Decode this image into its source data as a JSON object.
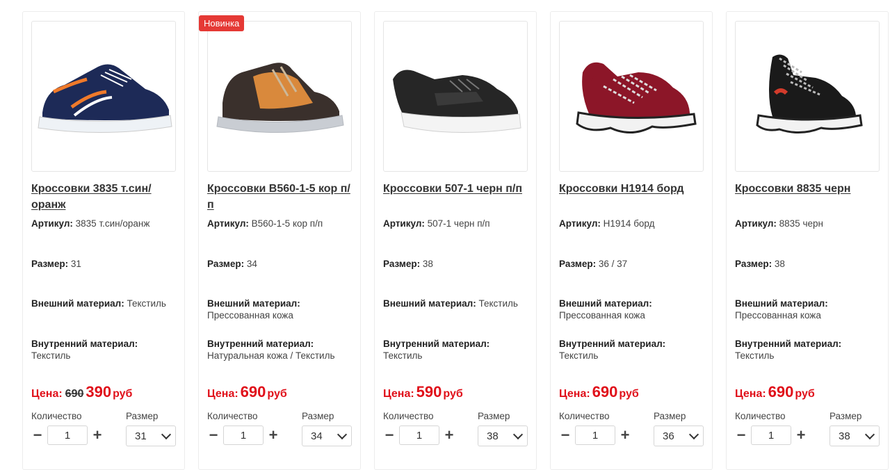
{
  "labels": {
    "article": "Артикул:",
    "size": "Размер:",
    "outer_material": "Внешний материал:",
    "inner_material": "Внутренний материал:",
    "price": "Цена:",
    "currency": "руб",
    "quantity": "Количество",
    "size_select": "Размер",
    "minus": "−",
    "plus": "+"
  },
  "products": [
    {
      "badge": "",
      "title": "Кроссовки 3835 т.син/оранж",
      "article": "3835 т.син/оранж",
      "size": "31",
      "outer_material": "Текстиль",
      "inner_material": "Текстиль",
      "old_price": "690",
      "price": "390",
      "quantity": "1",
      "selected_size": "31",
      "colors": {
        "upper": "#1d2a57",
        "accent": "#f07a2a",
        "sole": "#eef2f6"
      }
    },
    {
      "badge": "Новинка",
      "title": "Кроссовки B560-1-5 кор п/п",
      "article": "B560-1-5 кор п/п",
      "size": "34",
      "outer_material": "Прессованная кожа",
      "inner_material": "Натуральная кожа / Текстиль",
      "old_price": "",
      "price": "690",
      "quantity": "1",
      "selected_size": "34",
      "colors": {
        "upper": "#3a302c",
        "accent": "#d9893c",
        "sole": "#c9cdd3"
      }
    },
    {
      "badge": "",
      "title": "Кроссовки 507-1 черн п/п",
      "article": "507-1 черн п/п",
      "size": "38",
      "outer_material": "Текстиль",
      "inner_material": "Текстиль",
      "old_price": "",
      "price": "590",
      "quantity": "1",
      "selected_size": "38",
      "colors": {
        "upper": "#262626",
        "accent": "#3a3a3a",
        "sole": "#f4f4f4"
      }
    },
    {
      "badge": "",
      "title": "Кроссовки H1914 борд",
      "article": "H1914 борд",
      "size": "36 / 37",
      "outer_material": "Прессованная кожа",
      "inner_material": "Текстиль",
      "old_price": "",
      "price": "690",
      "quantity": "1",
      "selected_size": "36",
      "colors": {
        "upper": "#8c1628",
        "accent": "#dddddd",
        "sole": "#f2f2f2"
      }
    },
    {
      "badge": "",
      "title": "Кроссовки 8835 черн",
      "article": "8835 черн",
      "size": "38",
      "outer_material": "Прессованная кожа",
      "inner_material": "Текстиль",
      "old_price": "",
      "price": "690",
      "quantity": "1",
      "selected_size": "38",
      "colors": {
        "upper": "#1a1a1a",
        "accent": "#d23b2b",
        "sole": "#f2f2f2"
      }
    }
  ]
}
